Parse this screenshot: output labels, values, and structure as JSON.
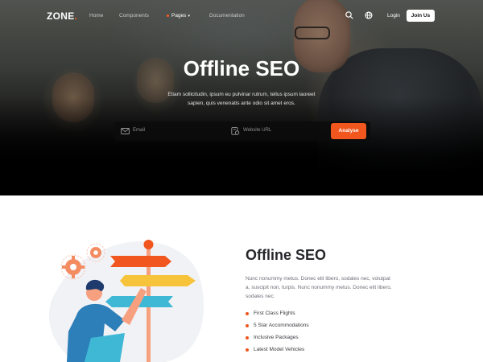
{
  "nav": {
    "logo": "ZONE",
    "logo_dot": ".",
    "links": [
      {
        "label": "Home"
      },
      {
        "label": "Components"
      },
      {
        "label": "Pages"
      },
      {
        "label": "Documentation"
      }
    ],
    "pages_caret": "▾",
    "login": "Login",
    "join": "Join Us",
    "accent": "#ff5a1f"
  },
  "hero": {
    "title": "Offline SEO",
    "subtitle": "Etiam sollicitudin, ipsum eu pulvinar rutrum, tellus ipsum laoreet sapien, quis venenatis ante odio sit amet eros.",
    "email_placeholder": "Email",
    "website_placeholder": "Website URL",
    "analyse_label": "Analyse",
    "button_color": "#f0561d"
  },
  "section": {
    "title": "Offline SEO",
    "body": "Nunc nonummy metus. Donec elit libero, sodales nec, volutpat a, suscipit non, turpis. Nunc nonummy metus. Donec elit libero, sodales nec.",
    "list": [
      "First Class Flights",
      "5 Star Accommodations",
      "Inclusive Packages",
      "Latest Model Vehicles"
    ]
  }
}
